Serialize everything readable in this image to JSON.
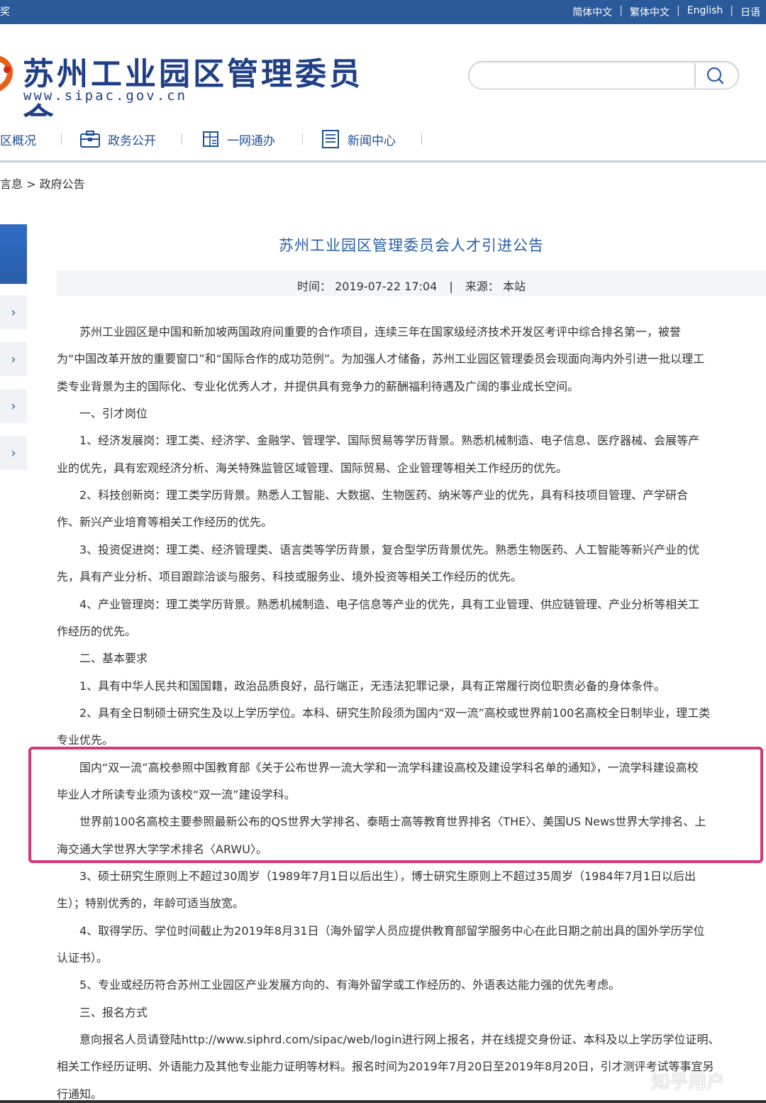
{
  "topbar": {
    "left_text": "奖",
    "languages": [
      "简体中文",
      "繁体中文",
      "English",
      "日语"
    ],
    "separator": "|"
  },
  "header": {
    "site_title": "苏州工业园区管理委员会",
    "site_url": "www.sipac.gov.cn",
    "search_placeholder": ""
  },
  "nav": {
    "items": [
      "区概况",
      "政务公开",
      "一网通办",
      "新闻中心"
    ]
  },
  "breadcrumb": "言息 > 政府公告",
  "sidebar": {
    "chevron": "›"
  },
  "article": {
    "title": "苏州工业园区管理委员会人才引进公告",
    "meta_time_label": "时间：",
    "meta_time": "2019-07-22 17:04",
    "meta_sep": "|",
    "meta_source_label": "来源：",
    "meta_source": "本站",
    "lines": [
      "　　苏州工业园区是中国和新加坡两国政府间重要的合作项目，连续三年在国家级经济技术开发区考评中综合排名第一，被誉",
      "为“中国改革开放的重要窗口”和“国际合作的成功范例”。为加强人才储备，苏州工业园区管理委员会现面向海内外引进一批以理工",
      "类专业背景为主的国际化、专业化优秀人才，并提供具有竞争力的薪酬福利待遇及广阔的事业成长空间。",
      "　　一、引才岗位",
      "　　1、经济发展岗：理工类、经济学、金融学、管理学、国际贸易等学历背景。熟悉机械制造、电子信息、医疗器械、会展等产",
      "业的优先，具有宏观经济分析、海关特殊监管区域管理、国际贸易、企业管理等相关工作经历的优先。",
      "　　2、科技创新岗：理工类学历背景。熟悉人工智能、大数据、生物医药、纳米等产业的优先，具有科技项目管理、产学研合",
      "作、新兴产业培育等相关工作经历的优先。",
      "　　3、投资促进岗：理工类、经济管理类、语言类等学历背景，复合型学历背景优先。熟悉生物医药、人工智能等新兴产业的优",
      "先，具有产业分析、项目跟踪洽谈与服务、科技或服务业、境外投资等相关工作经历的优先。",
      "　　4、产业管理岗：理工类学历背景。熟悉机械制造、电子信息等产业的优先，具有工业管理、供应链管理、产业分析等相关工",
      "作经历的优先。",
      "　　二、基本要求",
      "　　1、具有中华人民共和国国籍，政治品质良好，品行端正，无违法犯罪记录，具有正常履行岗位职责必备的身体条件。",
      "　　2、具有全日制硕士研究生及以上学历学位。本科、研究生阶段须为国内“双一流”高校或世界前100名高校全日制毕业，理工类",
      "专业优先。",
      "　　国内“双一流”高校参照中国教育部《关于公布世界一流大学和一流学科建设高校及建设学科名单的通知》，一流学科建设高校",
      "毕业人才所读专业须为该校“双一流”建设学科。",
      "　　世界前100名高校主要参照最新公布的QS世界大学排名、泰晤士高等教育世界排名〈THE〉、美国US News世界大学排名、上",
      "海交通大学世界大学学术排名〈ARWU〉。",
      "　　3、硕士研究生原则上不超过30周岁（1989年7月1日以后出生），博士研究生原则上不超过35周岁（1984年7月1日以后出",
      "生）；特别优秀的，年龄可适当放宽。",
      "　　4、取得学历、学位时间截止为2019年8月31日（海外留学人员应提供教育部留学服务中心在此日期之前出具的国外学历学位",
      "认证书）。",
      "　　5、专业或经历符合苏州工业园区产业发展方向的、有海外留学或工作经历的、外语表达能力强的优先考虑。",
      "　　三、报名方式",
      "　　意向报名人员请登陆http://www.siphrd.com/sipac/web/login进行网上报名，并在线提交身份证、本科及以上学历学位证明、",
      "相关工作经历证明、外语能力及其他专业能力证明等材料。报名时间为2019年7月20日至2019年8月20日，引才测评考试等事宜另",
      "行通知。"
    ]
  },
  "watermark": "知乎用户",
  "colors": {
    "topbar": "#2a5a9a",
    "brand_blue": "#1f3f86",
    "link_blue": "#2a5ea8",
    "highlight_border": "#d3387a"
  },
  "icons": {
    "search": "search-icon",
    "nav": [
      "briefcase-icon",
      "document-grid-icon",
      "news-list-icon"
    ]
  }
}
